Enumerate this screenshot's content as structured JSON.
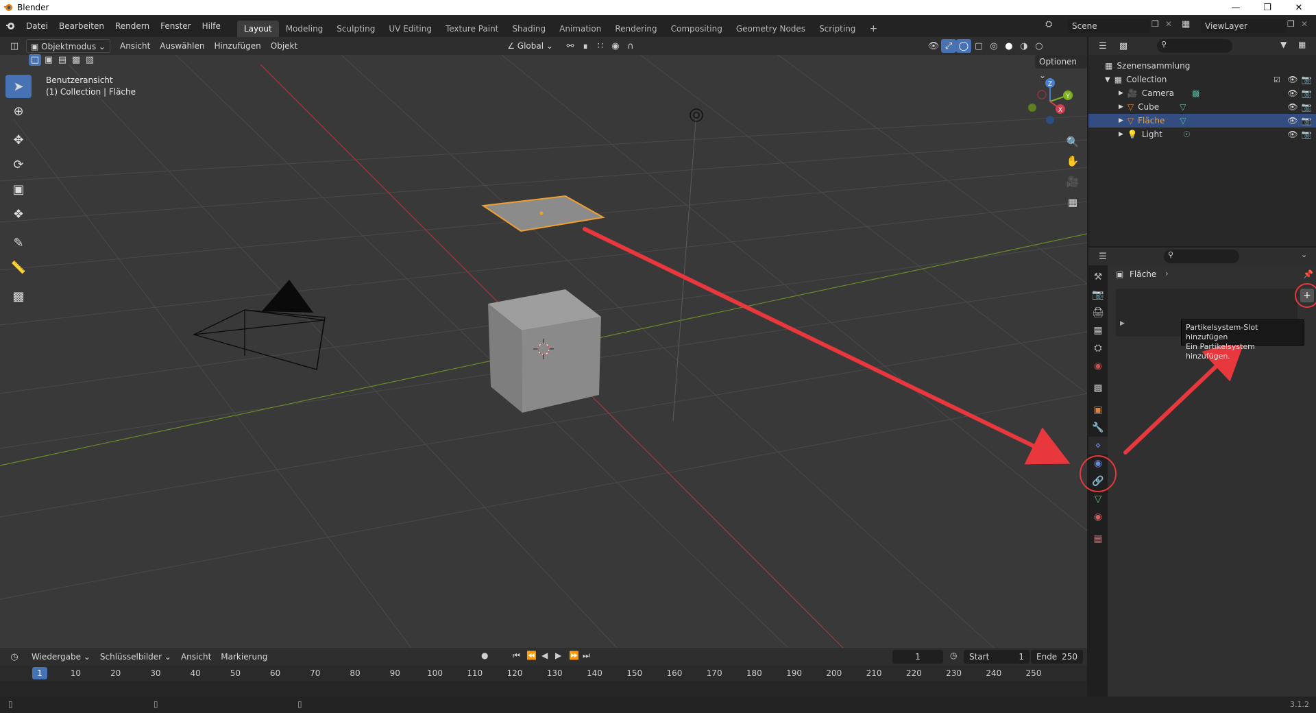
{
  "window": {
    "title": "Blender"
  },
  "menu": {
    "items": [
      "Datei",
      "Bearbeiten",
      "Rendern",
      "Fenster",
      "Hilfe"
    ],
    "workspaces": [
      "Layout",
      "Modeling",
      "Sculpting",
      "UV Editing",
      "Texture Paint",
      "Shading",
      "Animation",
      "Rendering",
      "Compositing",
      "Geometry Nodes",
      "Scripting"
    ],
    "add_workspace": "+",
    "scene": "Scene",
    "view_layer": "ViewLayer"
  },
  "viewport": {
    "mode": "Objektmodus",
    "menus": [
      "Ansicht",
      "Auswählen",
      "Hinzufügen",
      "Objekt"
    ],
    "transform_orientation": "Global",
    "options": "Optionen",
    "view_name": "Benutzeransicht",
    "collection_info": "(1) Collection | Fläche",
    "gizmo": {
      "x": "X",
      "y": "Y",
      "z": "Z"
    }
  },
  "outliner": {
    "root": "Szenensammlung",
    "collection": "Collection",
    "items": [
      {
        "name": "Camera",
        "color": "#e0803a"
      },
      {
        "name": "Cube",
        "color": "#e0803a"
      },
      {
        "name": "Fläche",
        "color": "#e0803a",
        "selected": true
      },
      {
        "name": "Light",
        "color": "#e0803a"
      }
    ]
  },
  "properties": {
    "object_name": "Fläche",
    "add_slot": "+",
    "tooltip_title": "Partikelsystem-Slot hinzufügen",
    "tooltip_desc": "Ein Partikelsystem hinzufügen."
  },
  "timeline": {
    "menus": [
      "Wiedergabe",
      "Schlüsselbilder",
      "Ansicht",
      "Markierung"
    ],
    "current_frame": "1",
    "start_label": "Start",
    "start_value": "1",
    "end_label": "Ende",
    "end_value": "250",
    "ticks": [
      "1",
      "10",
      "20",
      "30",
      "40",
      "50",
      "60",
      "70",
      "80",
      "90",
      "100",
      "110",
      "120",
      "130",
      "140",
      "150",
      "160",
      "170",
      "180",
      "190",
      "200",
      "210",
      "220",
      "230",
      "240",
      "250"
    ]
  },
  "status": {
    "version": "3.1.2"
  },
  "colors": {
    "accent": "#4772b3",
    "selected_row": "#334d80",
    "annotation": "#e8383d",
    "selection_outline": "#f0a030"
  }
}
